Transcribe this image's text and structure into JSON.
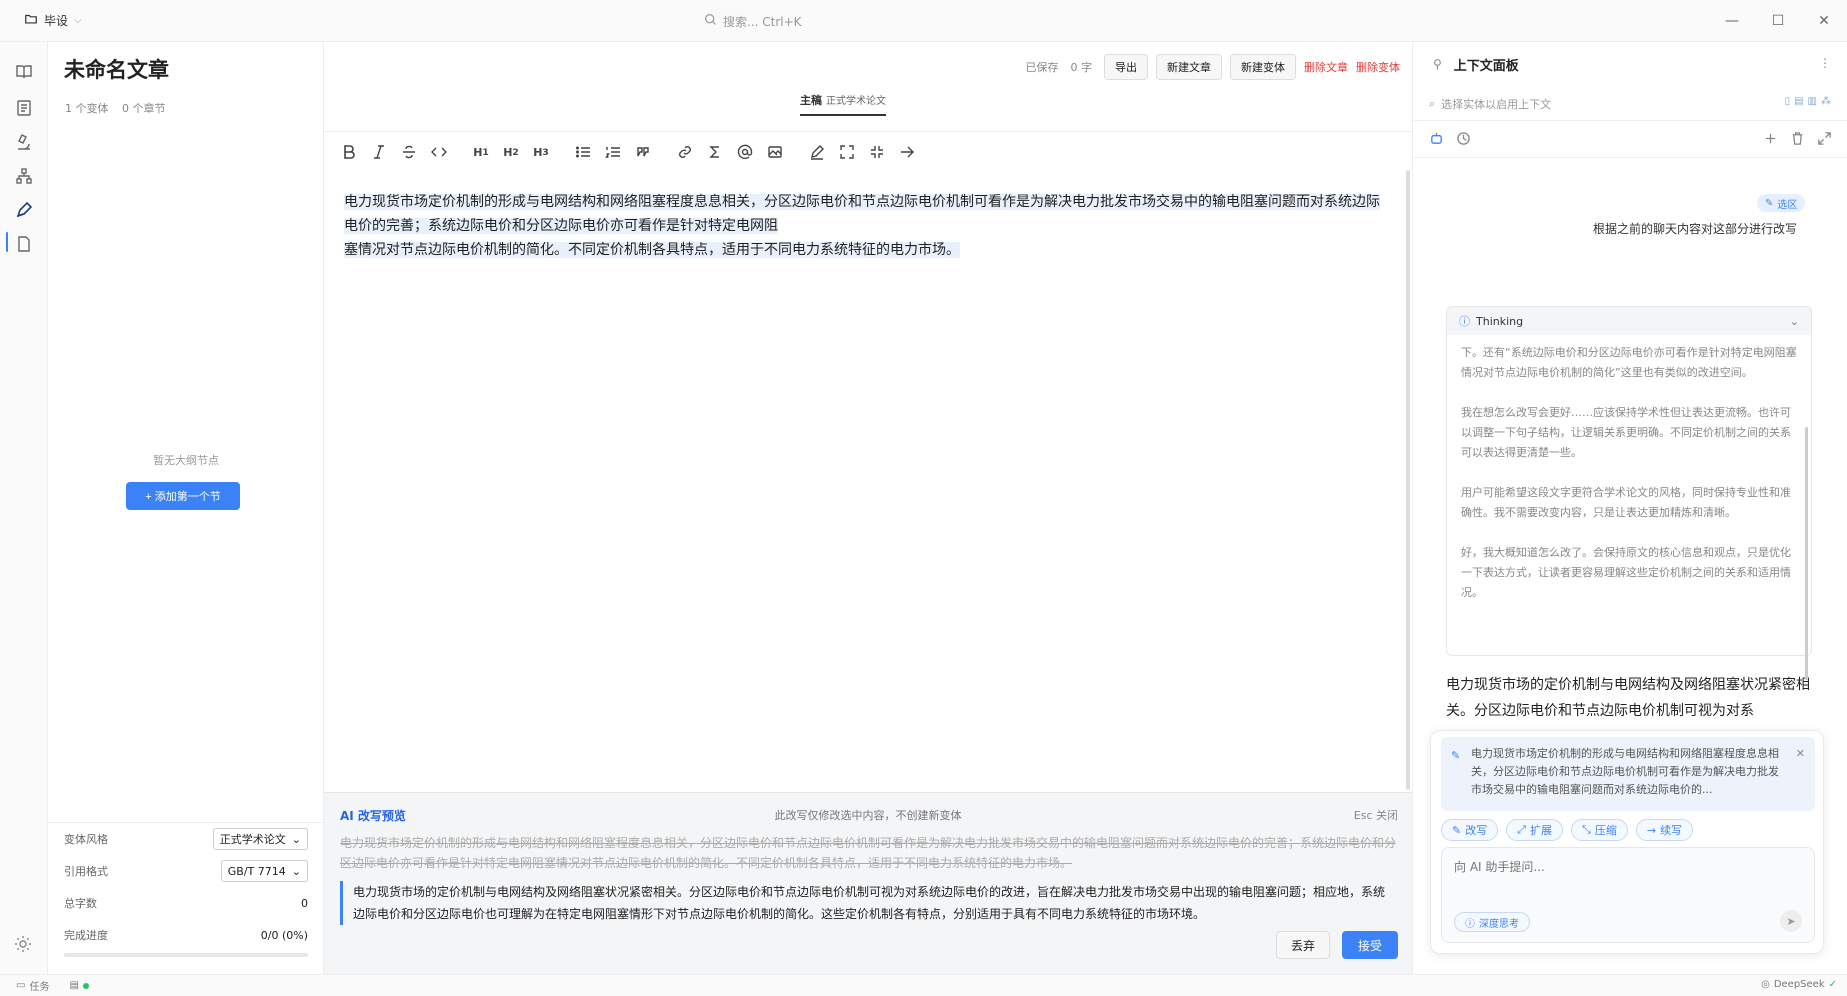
{
  "titlebar": {
    "project": "毕设",
    "search_placeholder": "搜索... Ctrl+K"
  },
  "outline": {
    "doc_title": "未命名文章",
    "meta_variants": "1 个变体",
    "meta_sections": "0 个章节",
    "empty_text": "暂无大纲节点",
    "add_button": "+ 添加第一个节"
  },
  "properties": {
    "style_label": "变体风格",
    "style_value": "正式学术论文",
    "citation_label": "引用格式",
    "citation_value": "GB/T 7714",
    "words_label": "总字数",
    "words_value": "0",
    "progress_label": "完成进度",
    "progress_value": "0/0 (0%)",
    "progress_fraction": 0
  },
  "editor": {
    "saved": "已保存",
    "word_count": "0 字",
    "export": "导出",
    "new_article": "新建文章",
    "new_variant": "新建变体",
    "delete_article": "删除文章",
    "delete_variant": "删除变体",
    "tab_main": "主稿",
    "tab_sub": "正式学术论文",
    "content_line1": "电力现货市场定价机制的形成与电网结构和网络阻塞程度息息相关，分区边际电价和节点边际电价机制可看作是为解决电力批发市场交易中的输电阻塞问题而对系统边际电价的完善；系统边际电价和分区边际电价亦可看作是针对特定电网阻",
    "content_line2": "塞情况对节点边际电价机制的简化。不同定价机制各具特点，适用于不同电力系统特征的电力市场。"
  },
  "ai_preview": {
    "title": "AI 改写预览",
    "hint": "此改写仅修改选中内容，不创建新变体",
    "close": "Esc 关闭",
    "old_text": "电力现货市场定价机制的形成与电网结构和网络阻塞程度息息相关，分区边际电价和节点边际电价机制可看作是为解决电力批发市场交易中的输电阻塞问题而对系统边际电价的完善；系统边际电价和分区边际电价亦可看作是针对特定电网阻塞情况对节点边际电价机制的简化。不同定价机制各具特点，适用于不同电力系统特征的电力市场。",
    "new_text": "电力现货市场的定价机制与电网结构及网络阻塞状况紧密相关。分区边际电价和节点边际电价机制可视为对系统边际电价的改进，旨在解决电力批发市场交易中出现的输电阻塞问题；相应地，系统边际电价和分区边际电价也可理解为在特定电网阻塞情形下对节点边际电价机制的简化。这些定价机制各有特点，分别适用于具有不同电力系统特征的市场环境。",
    "discard": "丢弃",
    "accept": "接受"
  },
  "right_panel": {
    "title": "上下文面板",
    "search_placeholder": "选择实体以启用上下文",
    "selection_chip": "选区",
    "user_message": "根据之前的聊天内容对这部分进行改写",
    "thinking_label": "Thinking",
    "thinking_p1": "下。还有“系统边际电价和分区边际电价亦可看作是针对特定电网阻塞情况对节点边际电价机制的简化”这里也有类似的改进空间。",
    "thinking_p2": "我在想怎么改写会更好……应该保持学术性但让表达更流畅。也许可以调整一下句子结构，让逻辑关系更明确。不同定价机制之间的关系可以表达得更清楚一些。",
    "thinking_p3": "用户可能希望这段文字更符合学术论文的风格，同时保持专业性和准确性。我不需要改变内容，只是让表达更加精炼和清晰。",
    "thinking_p4": "好，我大概知道怎么改了。会保持原文的核心信息和观点，只是优化一下表达方式，让读者更容易理解这些定价机制之间的关系和适用情况。",
    "answer": "电力现货市场的定价机制与电网结构及网络阻塞状况紧密相关。分区边际电价和节点边际电价机制可视为对系",
    "quote": "电力现货市场定价机制的形成与电网结构和网络阻塞程度息息相关，分区边际电价和节点边际电价机制可看作是为解决电力批发市场交易中的输电阻塞问题而对系统边际电价的...",
    "action_rewrite": "改写",
    "action_expand": "扩展",
    "action_compress": "压缩",
    "action_continue": "续写",
    "input_placeholder": "向 AI 助手提问...",
    "deep_think": "深度思考"
  },
  "statusbar": {
    "tasks": "任务",
    "model": "DeepSeek"
  }
}
